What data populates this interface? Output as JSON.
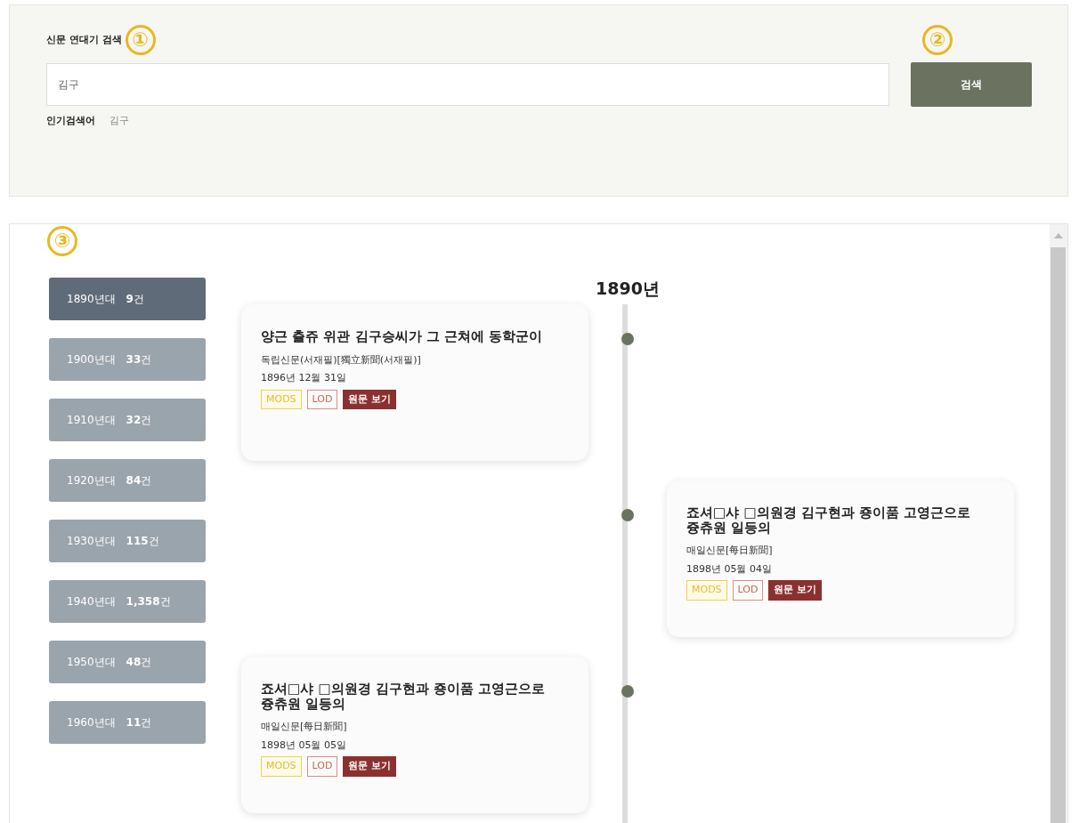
{
  "search": {
    "label": "신문 연대기 검색",
    "callout": "①",
    "value": "김구",
    "button": "검색",
    "button_callout": "②",
    "popular_label": "인기검색어",
    "popular_terms": [
      "김구"
    ]
  },
  "results": {
    "callout": "③",
    "decades": [
      {
        "label": "1890년대",
        "count": "9",
        "unit": "건",
        "selected": true
      },
      {
        "label": "1900년대",
        "count": "33",
        "unit": "건",
        "selected": false
      },
      {
        "label": "1910년대",
        "count": "32",
        "unit": "건",
        "selected": false
      },
      {
        "label": "1920년대",
        "count": "84",
        "unit": "건",
        "selected": false
      },
      {
        "label": "1930년대",
        "count": "115",
        "unit": "건",
        "selected": false
      },
      {
        "label": "1940년대",
        "count": "1,358",
        "unit": "건",
        "selected": false
      },
      {
        "label": "1950년대",
        "count": "48",
        "unit": "건",
        "selected": false
      },
      {
        "label": "1960년대",
        "count": "11",
        "unit": "건",
        "selected": false
      }
    ],
    "timeline": {
      "year": "1890년",
      "entries": [
        {
          "kind": "left",
          "title": "양근 츌쥬 위관 김구승씨가 그 근쳐에 동학군이",
          "source": "독립신문(서재필)[獨立新聞(서재필)]",
          "date": "1896년 12월 31일",
          "tags": [
            {
              "kind": "mods",
              "label": "MODS"
            },
            {
              "kind": "lod",
              "label": "LOD"
            },
            {
              "kind": "view",
              "label": "원문 보기"
            }
          ]
        },
        {
          "kind": "right",
          "title": "죠셔□샤 □의원경 김구현과 죵이품 고영근으로 즁츄원 일등의",
          "source": "매일신문[每日新聞]",
          "date": "1898년 05월 04일",
          "tags": [
            {
              "kind": "mods",
              "label": "MODS"
            },
            {
              "kind": "lod",
              "label": "LOD"
            },
            {
              "kind": "view",
              "label": "원문 보기"
            }
          ]
        },
        {
          "kind": "left",
          "title": "죠셔□샤 □의원경 김구현과 죵이품 고영근으로 즁츄원 일등의",
          "source": "매일신문[每日新聞]",
          "date": "1898년 05월 05일",
          "tags": [
            {
              "kind": "mods",
              "label": "MODS"
            },
            {
              "kind": "lod",
              "label": "LOD"
            },
            {
              "kind": "view",
              "label": "원문 보기"
            }
          ]
        }
      ]
    }
  }
}
